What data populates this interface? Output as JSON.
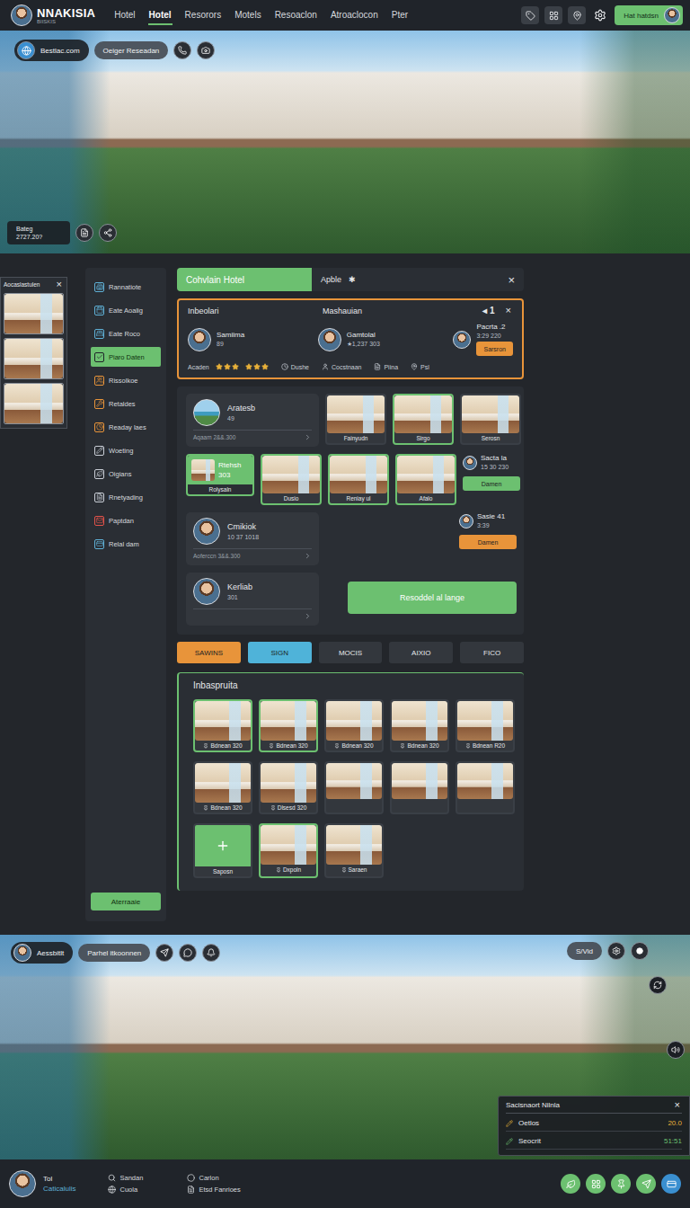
{
  "nav": {
    "logo": "NNAKISIA",
    "logo_sub": "BIISKIS",
    "items": [
      {
        "label": "Hotel",
        "selected": false
      },
      {
        "label": "Hotel",
        "selected": true
      },
      {
        "label": "Resorors",
        "selected": false
      },
      {
        "label": "Motels",
        "selected": false
      },
      {
        "label": "Resoaclon",
        "selected": false
      },
      {
        "label": "Atroaclocon",
        "selected": false
      },
      {
        "label": "Pter",
        "selected": false
      }
    ],
    "account": "Hat hatdsn"
  },
  "hero_top": {
    "site": "Bestlac.com",
    "action": "Oeiger Reseadan",
    "badge_label": "Bateg",
    "badge_value": "2727.20?"
  },
  "side_photos": {
    "title": "Aocaslastulen",
    "close": "×",
    "photos": [
      {
        "selected": false
      },
      {
        "selected": false
      },
      {
        "selected": false
      }
    ]
  },
  "sidebar": {
    "items": [
      {
        "label": "Rannatiote",
        "selected": false,
        "color": "#5fb0d6"
      },
      {
        "label": "Eate Aoalig",
        "selected": false,
        "color": "#5fb0d6"
      },
      {
        "label": "Eate Roco",
        "selected": false,
        "color": "#5fb0d6"
      },
      {
        "label": "Piaro Daten",
        "selected": true,
        "color": "#1f2329"
      },
      {
        "label": "Rissolkoe",
        "selected": false,
        "color": "#e8943a"
      },
      {
        "label": "Retaldes",
        "selected": false,
        "color": "#e8943a"
      },
      {
        "label": "Readay laes",
        "selected": false,
        "color": "#e8943a"
      },
      {
        "label": "Woeting",
        "selected": false,
        "color": "#c9ced6"
      },
      {
        "label": "Oigians",
        "selected": false,
        "color": "#c9ced6"
      },
      {
        "label": "Rnetyading",
        "selected": false,
        "color": "#c9ced6"
      },
      {
        "label": "Paptdan",
        "selected": false,
        "color": "#e0524a"
      },
      {
        "label": "Relal dam",
        "selected": false,
        "color": "#5fb0d6"
      }
    ],
    "button": "Aterraaie"
  },
  "panel_tabs": {
    "primary": "Cohvlain Hotel",
    "secondary": "Apble",
    "secondary_icon": "✱",
    "close": "×"
  },
  "staff": {
    "title": "Inbeolari",
    "subtitle": "Mashauian",
    "pager": "◂ 1",
    "close": "×",
    "members": [
      {
        "name": "Samiima",
        "detail": "89"
      },
      {
        "name": "Gamtolal",
        "detail": "★1,237 303"
      },
      {
        "name": "Pacrta .2",
        "detail": "3:29 220",
        "action": "Sarsron"
      }
    ],
    "rating_label": "Acaden",
    "ratings": [
      {
        "stars": 3
      },
      {
        "stars": 3
      }
    ],
    "tags": [
      "Dushe",
      "Cocstnaan",
      "Piina",
      "Psl"
    ]
  },
  "list": {
    "entries": [
      {
        "title": "Aratesb",
        "value": "49",
        "meta": "Aqaam 2&&.300"
      },
      {
        "title": "Cmikiok",
        "value": "10 37 1018",
        "meta": "Aoferccn 3&&.300"
      },
      {
        "title": "Kerliab",
        "value": "301"
      }
    ],
    "feature": {
      "title": "Rtehsh",
      "value": "303",
      "caption": "Rolysaln",
      "selected": true
    },
    "thumbs": [
      {
        "caption": "Fainyudn",
        "selected": false
      },
      {
        "caption": "Sirgo",
        "selected": true
      },
      {
        "caption": "Serosn",
        "selected": false
      },
      {
        "caption": "Dusio",
        "selected": true
      },
      {
        "caption": "Reniay ul",
        "selected": true
      },
      {
        "caption": "Afalo",
        "selected": true
      }
    ],
    "people": [
      {
        "name": "Sacta la",
        "detail": "15 30 230",
        "action": "Damen",
        "color": "#6cc070"
      },
      {
        "name": "Sasie 41",
        "detail": "3:39",
        "action": "Damen",
        "color": "#e8943a"
      }
    ],
    "wide_button": "Resoddel al lange"
  },
  "tabs": [
    {
      "label": "SAWINS",
      "color": "#e8943a"
    },
    {
      "label": "SIGN",
      "color": "#4fb3d9"
    },
    {
      "label": "MOCIS",
      "color": "#33373d"
    },
    {
      "label": "AIXIO",
      "color": "#33373d"
    },
    {
      "label": "FICO",
      "color": "#33373d"
    }
  ],
  "gallery": {
    "title": "Inbaspruita",
    "items": [
      {
        "kind": "photo",
        "caption": "Bdnean 320",
        "selected": true
      },
      {
        "kind": "photo",
        "caption": "Bdnean 320",
        "selected": true
      },
      {
        "kind": "photo",
        "caption": "Bdnean 320",
        "selected": false
      },
      {
        "kind": "photo",
        "caption": "Bdnean 320",
        "selected": false
      },
      {
        "kind": "photo",
        "caption": "Bdnean R20",
        "selected": false
      },
      {
        "kind": "photo",
        "caption": "Bdnean 320",
        "selected": false
      },
      {
        "kind": "photo",
        "caption": "Dlsesd 320",
        "selected": false
      },
      {
        "kind": "photo",
        "selected": false
      },
      {
        "kind": "photo",
        "selected": false
      },
      {
        "kind": "photo",
        "selected": false
      },
      {
        "kind": "add",
        "caption": "Saposn",
        "selected": false
      },
      {
        "kind": "photo",
        "caption": "Dxpoln",
        "selected": true
      },
      {
        "kind": "photo",
        "caption": "Saraen",
        "selected": false
      }
    ]
  },
  "hero_bottom": {
    "user": "Aessbitlt",
    "place": "Parhel itkoonnen",
    "media": "S/Vid",
    "stats_title": "Sacisnaort Nilnla",
    "stats_close": "×",
    "stats": [
      {
        "label": "Oetlos",
        "value": "20.0",
        "color": "#e8b13a"
      },
      {
        "label": "Seocrit",
        "value": "51:51",
        "color": "#6cc070"
      }
    ]
  },
  "footer": {
    "user": "Tol",
    "user_sub": "Caticalulis",
    "links": [
      "Sandan",
      "Carlon",
      "Cuola",
      "Etsd Fanrioes"
    ],
    "actions": [
      {
        "color": "#6cc070"
      },
      {
        "color": "#6cc070"
      },
      {
        "color": "#6cc070"
      },
      {
        "color": "#6cc070"
      },
      {
        "color": "#3a8fd0"
      }
    ]
  }
}
